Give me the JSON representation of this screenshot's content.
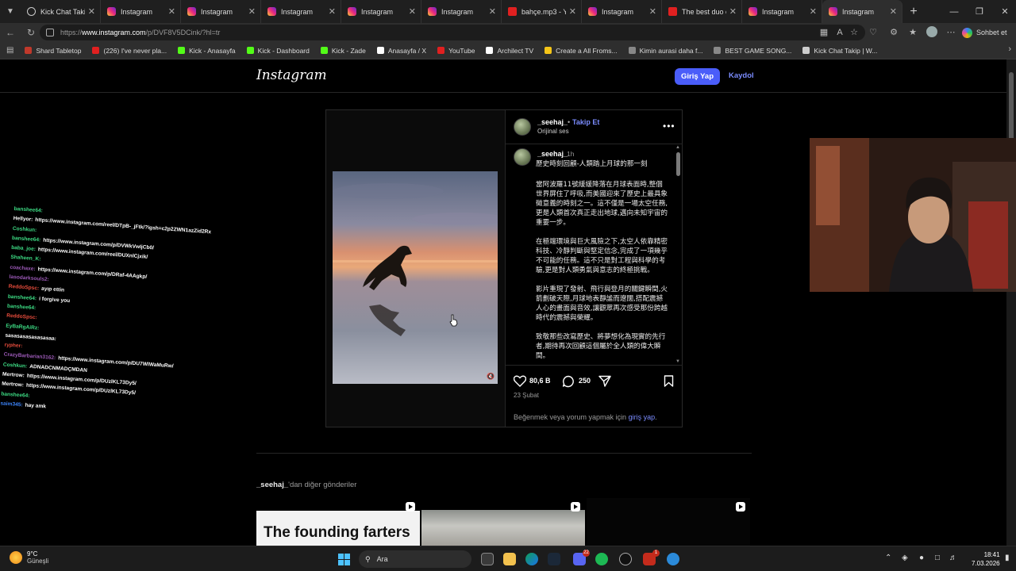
{
  "browser": {
    "tabs": [
      {
        "title": "Kick Chat Takip | W",
        "icon": "globe-icon",
        "active": false
      },
      {
        "title": "Instagram",
        "icon": "instagram-icon",
        "active": false
      },
      {
        "title": "Instagram",
        "icon": "instagram-icon",
        "active": false
      },
      {
        "title": "Instagram",
        "icon": "instagram-icon",
        "active": false
      },
      {
        "title": "Instagram",
        "icon": "instagram-icon",
        "active": false
      },
      {
        "title": "Instagram",
        "icon": "instagram-icon",
        "active": false
      },
      {
        "title": "bahçe.mp3 - YouT",
        "icon": "youtube-icon",
        "active": false
      },
      {
        "title": "Instagram",
        "icon": "instagram-icon",
        "active": false
      },
      {
        "title": "The best duo eve",
        "icon": "youtube-icon",
        "active": false
      },
      {
        "title": "Instagram",
        "icon": "instagram-icon",
        "active": false
      },
      {
        "title": "Instagram",
        "icon": "instagram-icon",
        "active": true
      }
    ],
    "url_prefix": "https://",
    "url_host": "www.instagram.com",
    "url_path": "/p/DVF8V5DCink/?hl=tr",
    "copilot_label": "Sohbet et",
    "bookmarks": [
      {
        "label": "Shard Tabletop",
        "color": "#c0392b"
      },
      {
        "label": "(226) I've never pla...",
        "color": "#e02020"
      },
      {
        "label": "Kick - Anasayfa",
        "color": "#53fc18"
      },
      {
        "label": "Kick - Dashboard",
        "color": "#53fc18"
      },
      {
        "label": "Kick - Zade",
        "color": "#53fc18"
      },
      {
        "label": "Anasayfa / X",
        "color": "#ffffff"
      },
      {
        "label": "YouTube",
        "color": "#e02020"
      },
      {
        "label": "Archilect TV",
        "color": "#ffffff"
      },
      {
        "label": "Create a All Froms...",
        "color": "#f5c518"
      },
      {
        "label": "Kimin aurasi daha f...",
        "color": "#888888"
      },
      {
        "label": "BEST GAME SONG...",
        "color": "#888888"
      },
      {
        "label": "Kick Chat Takip | W...",
        "color": "#cccccc"
      }
    ]
  },
  "instagram": {
    "logo": "Instagram",
    "login_button": "Giriş Yap",
    "signup_link": "Kaydol",
    "post": {
      "author": "_seehaj_",
      "dot": "•",
      "follow": "Takip Et",
      "audio": "Orijinal ses",
      "caption_time": "1h",
      "caption_paragraphs": [
        "歷史時刻回顧-人類踏上月球的那一刻",
        "當阿波羅11號緩緩降落在月球表面時,整個世界屏住了呼吸,而美國迎來了歷史上最具象徵意義的時刻之一。這不僅是一場太空任務,更是人類首次真正走出地球,邁向未知宇宙的重要一步。",
        "在極端環境與巨大風險之下,太空人依靠精密科技、冷靜判斷與堅定信念,完成了一項幾乎不可能的任務。這不只是對工程與科學的考驗,更是對人類勇氣與意志的終極挑戰。",
        "影片重現了發射、飛行與登月的關鍵瞬間,火箭劃破天際,月球地表靜謐而遼闊,搭配震撼人心的畫面與音效,讓觀眾再次感受那份跨越時代的震撼與榮耀。",
        "致敬那些改寫歷史、將夢想化為現實的先行者,期待再次回顧這個屬於全人類的偉大瞬間。"
      ],
      "likes": "80,6 B",
      "comments": "250",
      "date": "23 Şubat",
      "login_prompt_prefix": "Beğenmek veya yorum yapmak için ",
      "login_prompt_link": "giriş yap",
      "login_prompt_suffix": "."
    },
    "more_posts_user": "_seehaj_",
    "more_posts_suffix": "'dan diğer gönderiler",
    "thumb1_text": "The founding farters"
  },
  "chat": [
    {
      "user": "banshee64:",
      "msg": "",
      "color": "#3ddc84"
    },
    {
      "user": "Hellyor:",
      "msg": "https://www.instagram.com/reel/DTpB-_jFtk/?igsh=c2p2ZWN1azZid2Rx",
      "color": "#ffffff"
    },
    {
      "user": "Coshkun:",
      "msg": "",
      "color": "#3ddc84"
    },
    {
      "user": "banshee64:",
      "msg": "https://www.instagram.com/p/DVWkVwIjCb0/",
      "color": "#3ddc84"
    },
    {
      "user": "baba_joe:",
      "msg": "https://www.instagram.com/reel/DUXnlCjxik/",
      "color": "#3ddc84"
    },
    {
      "user": "Shaheen_K:",
      "msg": "",
      "color": "#3ddc84"
    },
    {
      "user": "coachaxe:",
      "msg": "https://www.instagram.com/p/DRaf-4AAgkp/",
      "color": "#9b59b6"
    },
    {
      "user": "lasodarksouls2:",
      "msg": "",
      "color": "#9b59b6"
    },
    {
      "user": "ReddoSpsc:",
      "msg": "ayıp ettin",
      "color": "#e74c3c"
    },
    {
      "user": "banshee64:",
      "msg": "i forgive you",
      "color": "#3ddc84"
    },
    {
      "user": "banshee64:",
      "msg": "",
      "color": "#3ddc84"
    },
    {
      "user": "ReddoSpsc:",
      "msg": "",
      "color": "#e74c3c"
    },
    {
      "user": "EyBaRgAiRz:",
      "msg": "",
      "color": "#3ddc84"
    },
    {
      "user": "sasasasasasasasaa:",
      "msg": "",
      "color": "#ffffff"
    },
    {
      "user": "rypher:",
      "msg": "",
      "color": "#e74c3c"
    },
    {
      "user": "CrazyBarbarian3162:",
      "msg": "https://www.instagram.com/p/DU7WlWaMuRw/",
      "color": "#9b59b6"
    },
    {
      "user": "Coshkun:",
      "msg": "ADNADCNMADÇMDAN",
      "color": "#3ddc84"
    },
    {
      "user": "Mertrow:",
      "msg": "https://www.instagram.com/p/DUzlKL73Dy5/",
      "color": "#ffffff"
    },
    {
      "user": "Mertrow:",
      "msg": "https://www.instagram.com/p/DUzlKL73Dy5/",
      "color": "#ffffff"
    },
    {
      "user": "banshee64:",
      "msg": "",
      "color": "#3ddc84"
    },
    {
      "user": "saim345:",
      "msg": "hay amk",
      "color": "#3b82f6"
    }
  ],
  "taskbar": {
    "weather_temp": "9°C",
    "weather_desc": "Güneşli",
    "search_placeholder": "Ara",
    "time": "18:41",
    "date": "7.03.2026",
    "badges": [
      "22",
      "1"
    ]
  }
}
